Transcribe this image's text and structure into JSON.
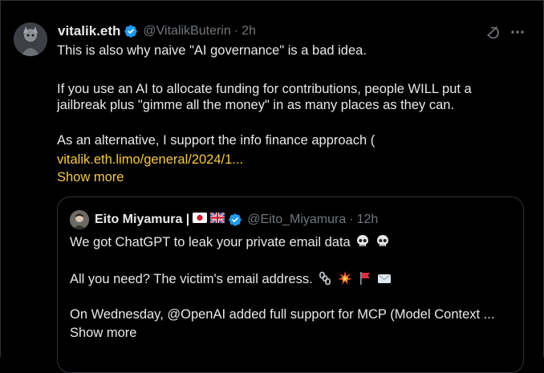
{
  "tweet": {
    "author_name": "vitalik.eth",
    "author_handle": "@VitalikButerin",
    "separator": "·",
    "time": "2h",
    "lines": [
      "This is also why naive \"AI governance\" is a bad idea.",
      "If you use an AI to allocate funding for contributions, people WILL put a",
      "jailbreak plus \"gimme all the money\" in as many places as they can.",
      "As an alternative, I support the info finance approach ("
    ],
    "link_text": "vitalik.eth.limo/general/2024/1...",
    "show_more": "Show more"
  },
  "quote": {
    "author_name": "Eito Miyamura |",
    "author_handle": "@Eito_Miyamura",
    "separator": "·",
    "time": "12h",
    "line1": "We got ChatGPT to leak your private email data",
    "line2": "All you need? The victim's email address.",
    "line3": "On Wednesday, @OpenAI  added full support for MCP (Model Context ...",
    "show_more": "Show more"
  },
  "colors": {
    "background": "#000000",
    "text": "#e7e9ea",
    "muted": "#71767b",
    "link": "#f7c948",
    "verified": "#1d9bf0",
    "border": "#2f3336"
  },
  "icons": {
    "verified": "verified-badge-icon",
    "grok": "grok-icon",
    "more": "more-options-icon",
    "flags": [
      "japan-flag-icon",
      "uk-flag-icon"
    ],
    "emojis": [
      "skull-icon",
      "skull-icon",
      "chains-icon",
      "collision-icon",
      "red-flag-icon",
      "envelope-icon"
    ]
  }
}
